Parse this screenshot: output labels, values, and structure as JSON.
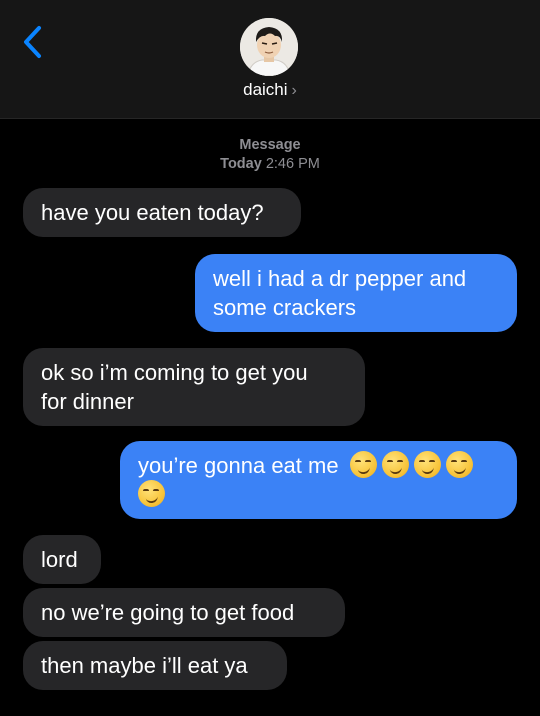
{
  "header": {
    "contact_name": "daichi",
    "chevron": "›"
  },
  "timestamp": {
    "service": "Message",
    "day": "Today",
    "time": "2:46 PM"
  },
  "messages": [
    {
      "direction": "incoming",
      "text": "have you eaten today?"
    },
    {
      "direction": "outgoing",
      "lines": [
        "well i had a dr pepper and",
        "some crackers"
      ]
    },
    {
      "direction": "incoming",
      "lines": [
        "ok so i’m coming to get you",
        "for dinner"
      ]
    },
    {
      "direction": "outgoing",
      "text": "you’re gonna eat me",
      "emoji": "smirking-face",
      "emoji_count": 5
    },
    {
      "direction": "incoming",
      "text": "lord"
    },
    {
      "direction": "incoming",
      "text": "no we’re going to get food"
    },
    {
      "direction": "incoming",
      "text": "then maybe i’ll eat ya"
    }
  ],
  "colors": {
    "incoming_bubble": "#262628",
    "outgoing_bubble": "#3b82f6",
    "back_arrow": "#0a84ff"
  }
}
